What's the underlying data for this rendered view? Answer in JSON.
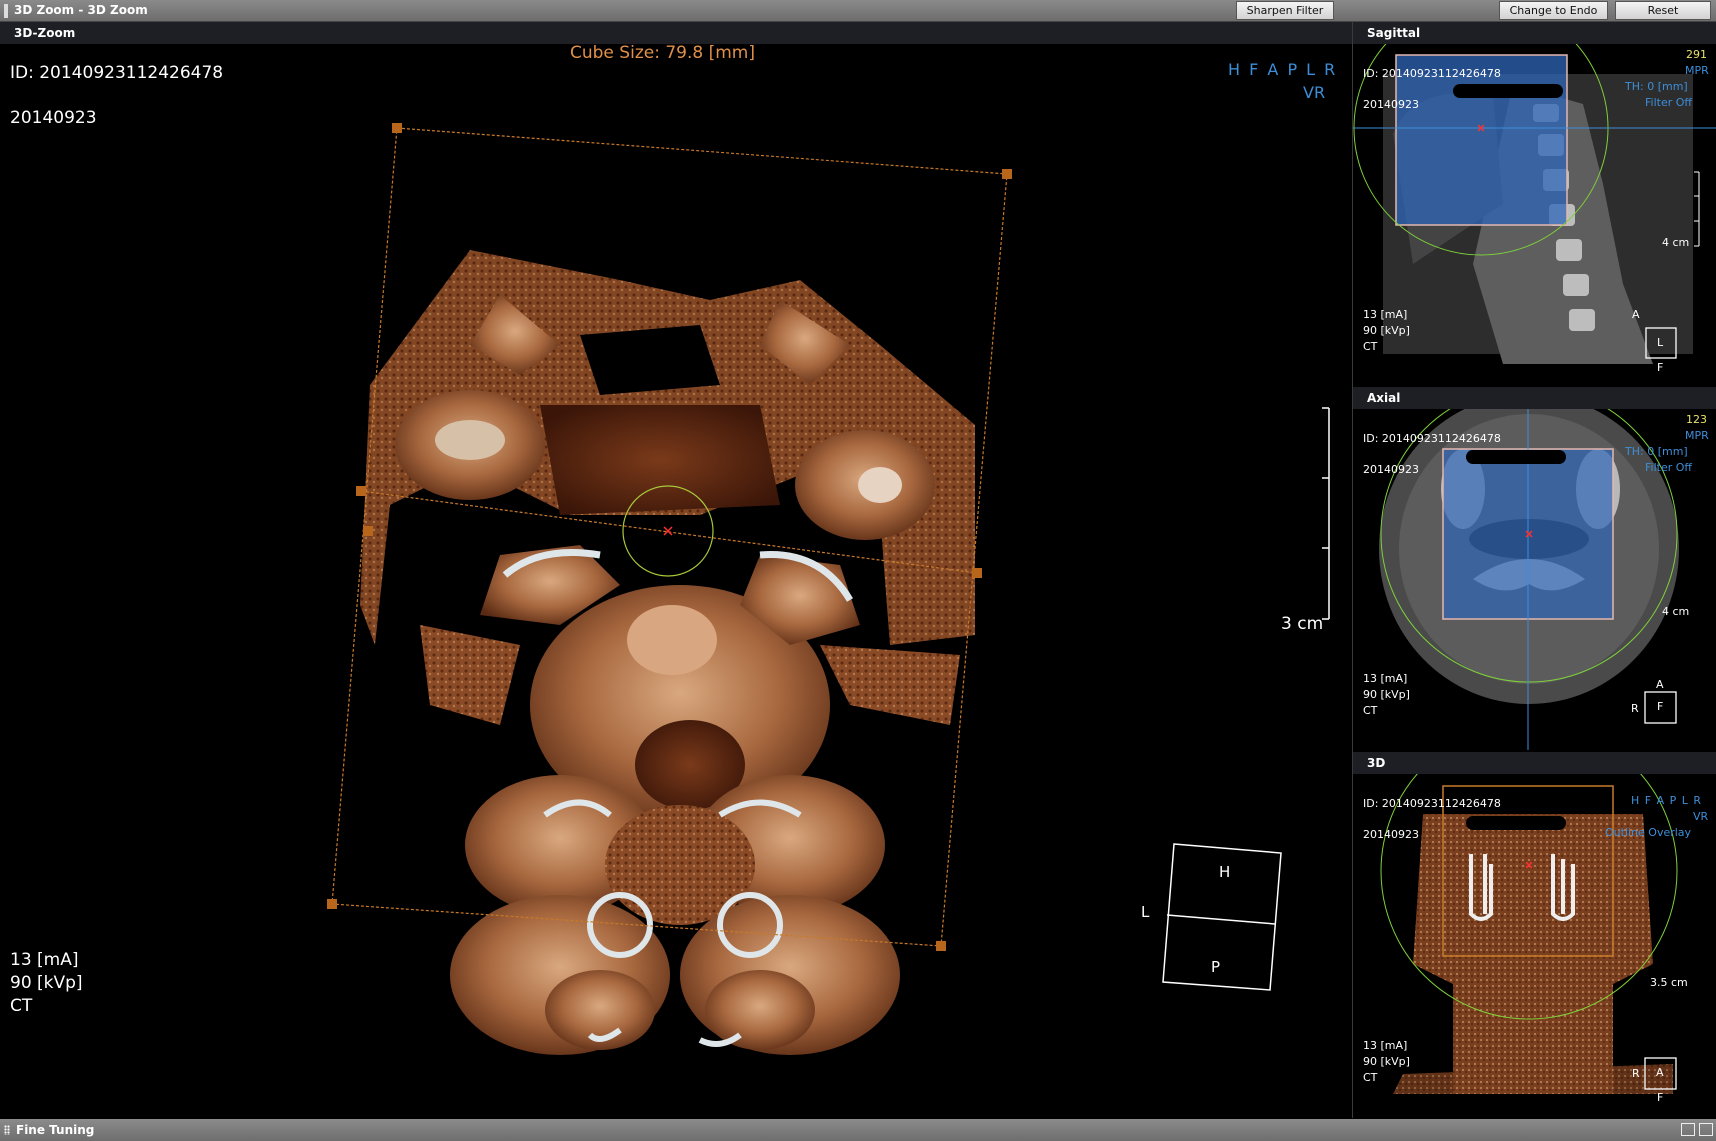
{
  "window": {
    "title": "3D Zoom - 3D Zoom",
    "buttons": {
      "sharpen_filter": "Sharpen Filter",
      "change_to_endo": "Change to Endo",
      "reset": "Reset"
    }
  },
  "main": {
    "header": "3D-Zoom",
    "cube_size": "Cube Size: 79.8 [mm]",
    "patient_id": "ID: 20140923112426478",
    "date": "20140923",
    "orientation": "H F A P L R",
    "render_mode": "VR",
    "scale_label": "3 cm",
    "ma": "13 [mA]",
    "kvp": "90 [kVp]",
    "modality": "CT",
    "orient_cube": {
      "top": "H",
      "bottom": "P",
      "left": "L"
    }
  },
  "sagittal": {
    "header": "Sagittal",
    "id": "ID: 20140923112426478",
    "date": "20140923",
    "slice": "291",
    "mode": "MPR",
    "th": "TH: 0 [mm]",
    "filter": "Filter Off",
    "scale": "4 cm",
    "ma": "13 [mA]",
    "kvp": "90 [kVp]",
    "modality": "CT",
    "orient": {
      "box": "L",
      "left": "A",
      "bottom": "F"
    }
  },
  "axial": {
    "header": "Axial",
    "id": "ID: 20140923112426478",
    "date": "20140923",
    "slice": "123",
    "mode": "MPR",
    "th": "TH: 0 [mm]",
    "filter": "Filter Off",
    "scale": "4 cm",
    "ma": "13 [mA]",
    "kvp": "90 [kVp]",
    "modality": "CT",
    "orient": {
      "box": "F",
      "top": "A",
      "left": "R"
    }
  },
  "view3d": {
    "header": "3D",
    "id": "ID: 20140923112426478",
    "date": "20140923",
    "orientation": "H F A P L R",
    "mode": "VR",
    "overlay": "Outline Overlay",
    "scale": "3.5 cm",
    "ma": "13 [mA]",
    "kvp": "90 [kVp]",
    "modality": "CT",
    "orient": {
      "box": "A",
      "left": "R",
      "bottom": "F"
    }
  },
  "bottom": {
    "label": "Fine Tuning"
  },
  "colors": {
    "cube_text": "#e0904a",
    "orientation_text": "#3d8ed8",
    "bone": "#b07a55",
    "box_outline": "#c87a2a",
    "circle": "#7fd13a"
  }
}
